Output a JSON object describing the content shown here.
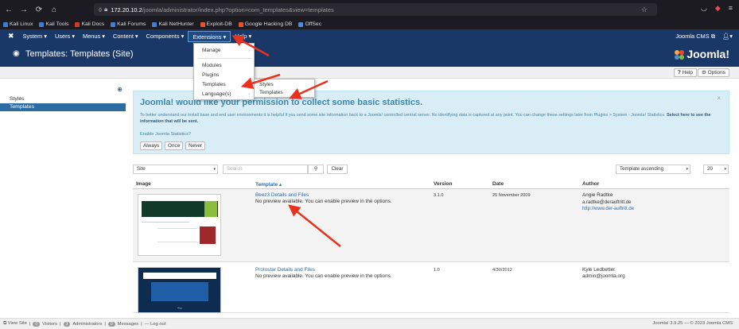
{
  "browser": {
    "url_host": "172.20.10.2",
    "url_path": "/joomla/administrator/index.php?option=com_templates&view=templates",
    "bookmarks": [
      "Kali Linux",
      "Kali Tools",
      "Kali Docs",
      "Kali Forums",
      "Kali NetHunter",
      "Exploit-DB",
      "Google Hacking DB",
      "OffSec"
    ],
    "bookmark_colors": [
      "#3f7fd1",
      "#3f7fd1",
      "#d03a2a",
      "#3f7fd1",
      "#3f7fd1",
      "#e8542a",
      "#e8542a",
      "#4f8ad8"
    ]
  },
  "adminbar": {
    "menu": [
      "System",
      "Users",
      "Menus",
      "Content",
      "Components",
      "Extensions",
      "Help"
    ],
    "site_name": "Joomla CMS"
  },
  "header": {
    "title": "Templates: Templates (Site)",
    "logo": "Joomla!"
  },
  "toolbar": {
    "help": "Help",
    "options": "Options"
  },
  "sidebar": {
    "items": [
      "Styles",
      "Templates"
    ]
  },
  "extensions_menu": {
    "items": [
      "Manage",
      "Modules",
      "Plugins",
      "Templates",
      "Language(s)"
    ]
  },
  "templates_submenu": {
    "items": [
      "Styles",
      "Templates"
    ]
  },
  "alert": {
    "title": "Joomla! would like your permission to collect some basic statistics.",
    "body": "To better understand our install base and end user environments it is helpful if you send some site information back to a Joomla! controlled central server. No identifying data is captured at any point. You can change these settings later from Plugins > System - Joomla! Statistics.",
    "body_bold": "Select here to see the information that will be sent.",
    "enable": "Enable Joomla Statistics?",
    "buttons": [
      "Always",
      "Once",
      "Never"
    ]
  },
  "filter": {
    "client": "Site",
    "search_placeholder": "Search",
    "clear": "Clear",
    "sort": "Template ascending",
    "limit": "20"
  },
  "table": {
    "headers": [
      "Image",
      "Template ▴",
      "Version",
      "Date",
      "Author"
    ],
    "rows": [
      {
        "name": "Beez3 Details and Files",
        "note": "No preview available. You can enable preview in the options.",
        "version": "3.1.0",
        "date": "25 November 2009",
        "author": "Angie Radtke",
        "email": "a.radtke@derauftritt.de",
        "url": "http://www.der-auftritt.de"
      },
      {
        "name": "Protostar Details and Files",
        "note": "No preview available. You can enable preview in the options.",
        "version": "1.0",
        "date": "4/30/2012",
        "author": "Kyle Ledbetter",
        "email": "admin@joomla.org",
        "url": ""
      }
    ]
  },
  "status": {
    "view_site": "View Site",
    "visitors_count": "0",
    "visitors": "Visitors",
    "admins_count": "3",
    "admins": "Administrators",
    "messages_count": "0",
    "messages": "Messages",
    "logout": "Log out",
    "version": "Joomla! 3.9.25 — © 2023 Joomla CMS"
  }
}
